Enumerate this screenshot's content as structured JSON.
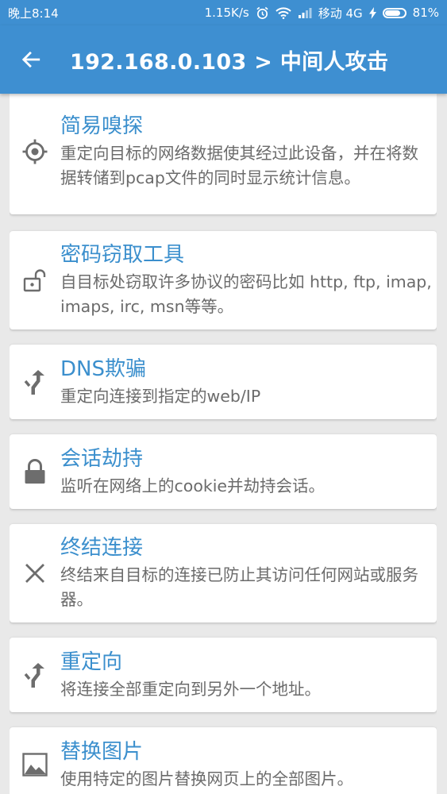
{
  "status_bar": {
    "time": "晚上8:14",
    "net_speed": "1.15K/s",
    "carrier": "移动 4G",
    "battery": "81%",
    "battery_level": 0.81
  },
  "app_bar": {
    "back_icon": "arrow-left-icon",
    "title": "192.168.0.103 > 中间人攻击"
  },
  "items": [
    {
      "icon": "crosshair-icon",
      "title": "简易嗅探",
      "desc": "重定向目标的网络数据使其经过此设备，并在将数据转储到pcap文件的同时显示统计信息。"
    },
    {
      "icon": "unlocked-padlock-icon",
      "title": "密码窃取工具",
      "desc": "自目标处窃取许多协议的密码比如 http, ftp, imap, imaps, irc, msn等等。"
    },
    {
      "icon": "fork-arrow-icon",
      "title": "DNS欺骗",
      "desc": "重定向连接到指定的web/IP"
    },
    {
      "icon": "padlock-icon",
      "title": "会话劫持",
      "desc": "监听在网络上的cookie并劫持会话。"
    },
    {
      "icon": "close-x-icon",
      "title": "终结连接",
      "desc": "终结来自目标的连接已防止其访问任何网站或服务器。"
    },
    {
      "icon": "fork-arrow-icon",
      "title": "重定向",
      "desc": "将连接全部重定向到另外一个地址。"
    },
    {
      "icon": "image-icon",
      "title": "替换图片",
      "desc": "使用特定的图片替换网页上的全部图片。"
    }
  ]
}
